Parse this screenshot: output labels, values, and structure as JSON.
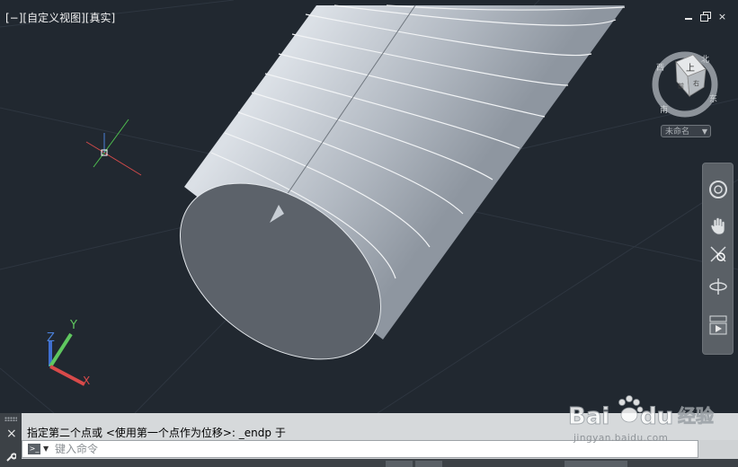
{
  "viewport": {
    "label": "[−][自定义视图][真实]",
    "background": "#212830"
  },
  "window_controls": {
    "minimize": "minimize-icon",
    "restore": "restore-icon",
    "close": "×"
  },
  "viewcube": {
    "top_face": "上",
    "front_face": "前",
    "right_face": "右",
    "north": "北",
    "west": "西",
    "east": "东",
    "south": "南"
  },
  "named_view": {
    "label": "未命名"
  },
  "navigation_bar": {
    "items": [
      "steering-wheel-icon",
      "pan-icon",
      "zoom-icon",
      "orbit-icon",
      "showmotion-icon"
    ]
  },
  "command_line": {
    "history": "指定第二个点或 <使用第一个点作为位移>: _endp 于",
    "placeholder": "键入命令",
    "close": "×"
  },
  "watermark": {
    "brand": "Bai",
    "brand2": "du",
    "brand_cn": "经验",
    "url": "jingyan.baidu.com"
  },
  "colors": {
    "accent_x": "#d84a4a",
    "accent_y": "#5fc75f",
    "accent_z": "#4a7fd8",
    "cylinder": "#a9b1bb"
  }
}
